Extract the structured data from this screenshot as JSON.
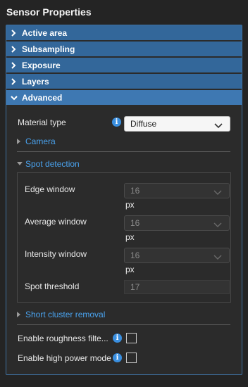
{
  "panel": {
    "title": "Sensor Properties"
  },
  "sections": [
    {
      "label": "Active area",
      "expanded": false
    },
    {
      "label": "Subsampling",
      "expanded": false
    },
    {
      "label": "Exposure",
      "expanded": false
    },
    {
      "label": "Layers",
      "expanded": false
    },
    {
      "label": "Advanced",
      "expanded": true
    }
  ],
  "advanced": {
    "material_type": {
      "label": "Material type",
      "value": "Diffuse"
    },
    "camera": {
      "label": "Camera"
    },
    "spot_detection": {
      "label": "Spot detection",
      "edge_window": {
        "label": "Edge window",
        "value": "16",
        "unit": "px"
      },
      "average_window": {
        "label": "Average window",
        "value": "16",
        "unit": "px"
      },
      "intensity_window": {
        "label": "Intensity window",
        "value": "16",
        "unit": "px"
      },
      "spot_threshold": {
        "label": "Spot threshold",
        "value": "17"
      }
    },
    "short_cluster_removal": {
      "label": "Short cluster removal"
    },
    "enable_roughness_filter": {
      "label": "Enable roughness filte...",
      "checked": false
    },
    "enable_high_power_mode": {
      "label": "Enable high power mode",
      "checked": false
    }
  },
  "colors": {
    "header": "#33679a",
    "header_expanded": "#3e78b2",
    "link": "#4aa3ef",
    "info": "#3a8fe0",
    "background": "#242424"
  },
  "icons": {
    "section_collapsed": "chevron-right-icon",
    "section_expanded": "chevron-down-icon",
    "info": "info-icon",
    "dropdown": "caret-down-icon"
  }
}
